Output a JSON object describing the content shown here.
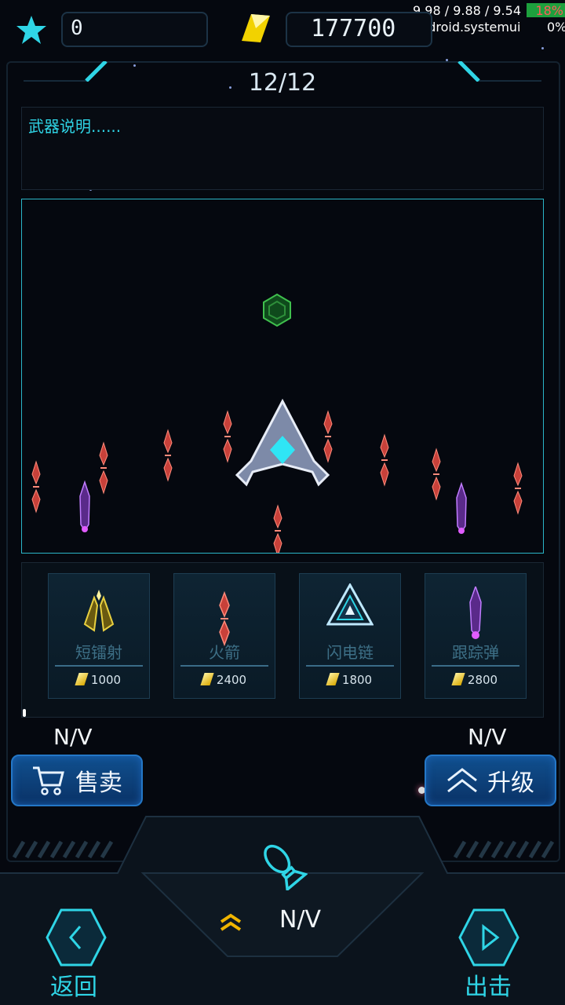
{
  "status_bar": {
    "fps": "9.98 / 9.88 / 9.54",
    "battery": "18%",
    "process": "com.android.systemui",
    "cpu": "0%"
  },
  "top_bar": {
    "score_value": "0",
    "gems_value": "177700"
  },
  "panel": {
    "page_counter": "12/12",
    "description": "武器说明......"
  },
  "weapons": [
    {
      "name": "短镭射",
      "price": "1000",
      "icon": "short-laser-icon"
    },
    {
      "name": "火箭",
      "price": "2400",
      "icon": "rocket-icon"
    },
    {
      "name": "闪电链",
      "price": "1800",
      "icon": "lightning-chain-icon"
    },
    {
      "name": "跟踪弹",
      "price": "2800",
      "icon": "homing-missile-icon"
    }
  ],
  "sell": {
    "value": "N/V",
    "label": "售卖"
  },
  "upgrade": {
    "value": "N/V",
    "label": "升级"
  },
  "bottom": {
    "weapon_level": "N/V",
    "back_label": "返回",
    "go_label": "出击"
  },
  "colors": {
    "accent": "#2fd5e6",
    "button": "#10508f",
    "gem": "#f2d200",
    "enemy_red": "#c8413a",
    "missile_purple": "#a24cd8"
  }
}
